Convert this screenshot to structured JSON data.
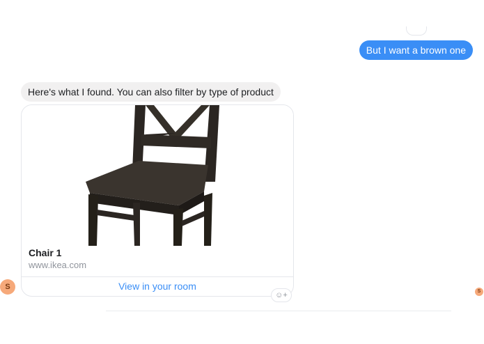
{
  "messages": {
    "outgoing": {
      "text": "But I want a brown one"
    },
    "incoming": {
      "text": "Here's what I found. You can also filter by type of product"
    }
  },
  "card": {
    "title": "Chair 1",
    "subtitle": "www.ikea.com",
    "action_label": "View in your room",
    "image": "brown-wooden-chair"
  },
  "avatar": {
    "initial": "S"
  },
  "seen_avatar": {
    "initial": "S"
  },
  "reaction_button": {
    "icon": "smiley-add-icon",
    "label": "☺+"
  },
  "colors": {
    "accent": "#3a8ef6",
    "incoming_bubble": "#f1f0f0",
    "avatar": "#f6a97a",
    "chair": "#2b2622"
  }
}
